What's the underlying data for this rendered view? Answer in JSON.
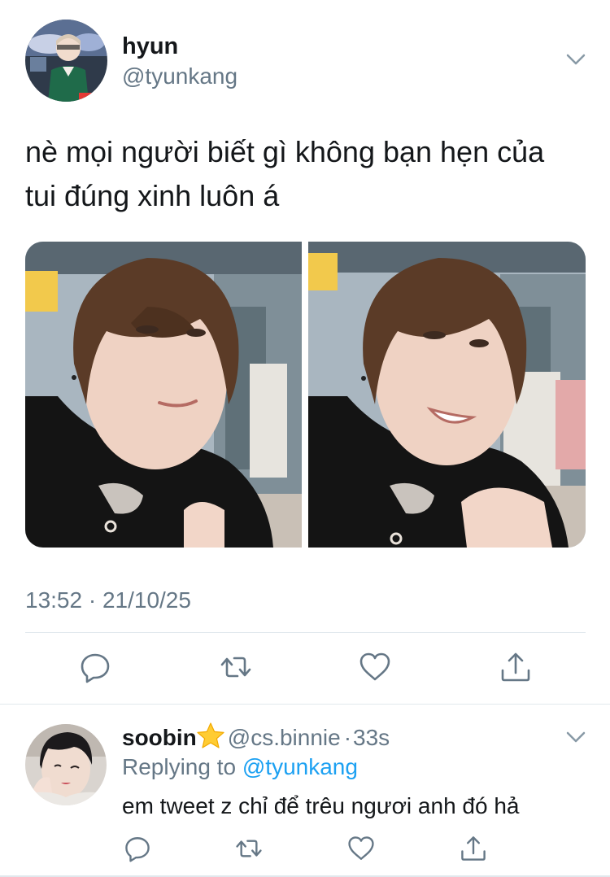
{
  "tweet": {
    "user": {
      "display_name": "hyun",
      "handle": "@tyunkang"
    },
    "text": "nè mọi người biết gì không bạn hẹn của tui đúng xinh luôn á",
    "timestamp": "13:52 · 21/10/25",
    "media_count": 2,
    "actions": [
      "reply",
      "retweet",
      "like",
      "share"
    ]
  },
  "reply": {
    "user": {
      "display_name": "soobin",
      "emoji": "star",
      "handle": "@cs.binnie",
      "separator": "·",
      "time": "33s"
    },
    "replying_to_label": "Replying to",
    "replying_to_handle": "@tyunkang",
    "text": "em tweet z chỉ để trêu ngươi anh đó hả",
    "actions": [
      "reply",
      "retweet",
      "like",
      "share"
    ]
  },
  "colors": {
    "text_primary": "#14171a",
    "text_secondary": "#657786",
    "link": "#1da1f2",
    "divider": "#e1e8ed"
  }
}
